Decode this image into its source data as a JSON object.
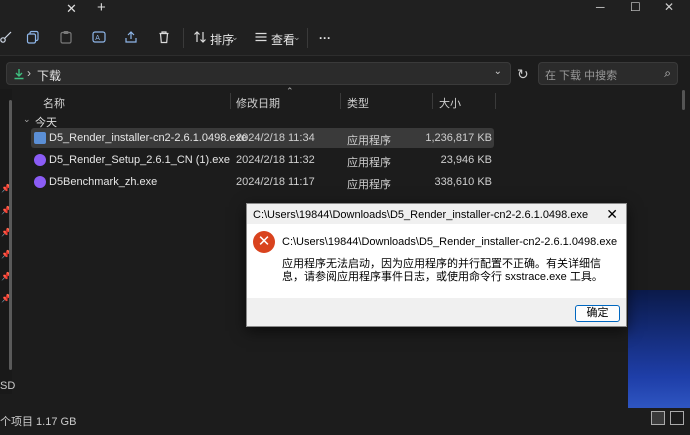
{
  "titlebar": {
    "close_glyph": "✕",
    "new_tab_glyph": "+"
  },
  "toolbar": {
    "sort_label": "排序",
    "view_label": "查看",
    "more_label": "···",
    "icons": [
      "cut-icon",
      "copy-icon",
      "paste-icon",
      "rename-icon",
      "share-icon",
      "delete-icon"
    ]
  },
  "address": {
    "crumb": "下载",
    "search_placeholder": "在 下载 中搜索"
  },
  "columns": {
    "name": "名称",
    "date": "修改日期",
    "type": "类型",
    "size": "大小"
  },
  "group": {
    "label": "今天"
  },
  "files": [
    {
      "name": "D5_Render_installer-cn2-2.6.1.0498.exe",
      "date": "2024/2/18 11:34",
      "type": "应用程序",
      "size": "1,236,817 KB",
      "icon_color": "#5b8fd6"
    },
    {
      "name": "D5_Render_Setup_2.6.1_CN (1).exe",
      "date": "2024/2/18 11:32",
      "type": "应用程序",
      "size": "23,946 KB",
      "icon_color": "#8b5cf6"
    },
    {
      "name": "D5Benchmark_zh.exe",
      "date": "2024/2/18 11:17",
      "type": "应用程序",
      "size": "338,610 KB",
      "icon_color": "#8b5cf6"
    }
  ],
  "leftnav": {
    "bottom_label": "SD"
  },
  "status": {
    "text": "个项目  1.17 GB"
  },
  "dialog": {
    "title": "C:\\Users\\19844\\Downloads\\D5_Render_installer-cn2-2.6.1.0498.exe",
    "path": "C:\\Users\\19844\\Downloads\\D5_Render_installer-cn2-2.6.1.0498.exe",
    "message": "应用程序无法启动，因为应用程序的并行配置不正确。有关详细信息，请参阅应用程序事件日志，或使用命令行 sxstrace.exe 工具。",
    "ok_label": "确定",
    "close_glyph": "✕"
  },
  "colors": {
    "accent": "#0067c0",
    "error": "#d9431e",
    "background": "#1c1c1c"
  }
}
